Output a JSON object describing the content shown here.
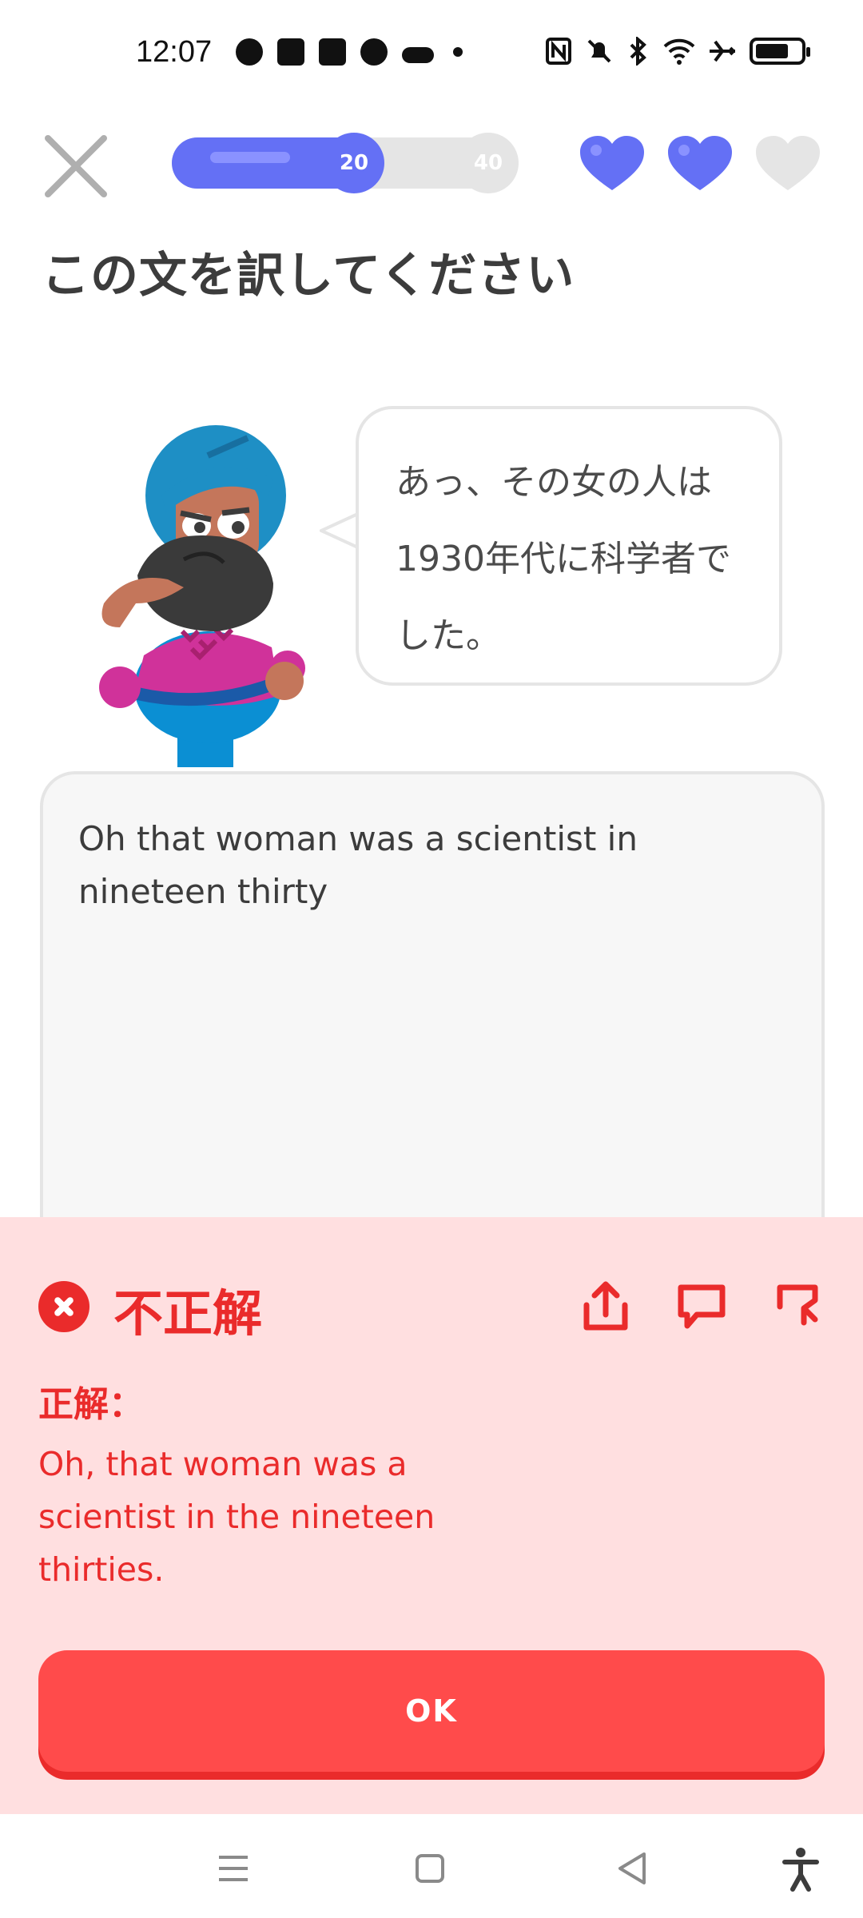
{
  "status_bar": {
    "time": "12:07",
    "left_icons": [
      "facebook-icon",
      "app-icon",
      "app-icon",
      "github-icon",
      "welcia-icon",
      "dot-icon"
    ],
    "right_icons": [
      "nfc-icon",
      "mute-icon",
      "bluetooth-icon",
      "wifi-icon",
      "airplane-icon",
      "battery-icon"
    ]
  },
  "lesson": {
    "progress_fraction": 0.58,
    "milestone_current": "20",
    "milestone_next": "40",
    "hearts_filled": 2,
    "hearts_total": 3,
    "accent_color": "#6470f5"
  },
  "instruction": "この文を訳してください",
  "prompt": {
    "line1": "あっ、その女の人は",
    "line2": "1930年代に科学者で",
    "line3": "した。"
  },
  "answer": {
    "value": "Oh that woman was a scientist in nineteen thirty"
  },
  "feedback": {
    "status": "不正解",
    "correct_label": "正解：",
    "correct_answer": "Oh, that woman was a scientist in the nineteen thirties.",
    "actions": [
      "share-icon",
      "comment-icon",
      "flag-icon"
    ],
    "color": "#ea2b2b",
    "background": "#ffdfe0"
  },
  "ok_button": "OK",
  "nav_bar": [
    "menu-icon",
    "home-icon",
    "back-icon",
    "accessibility-icon"
  ]
}
